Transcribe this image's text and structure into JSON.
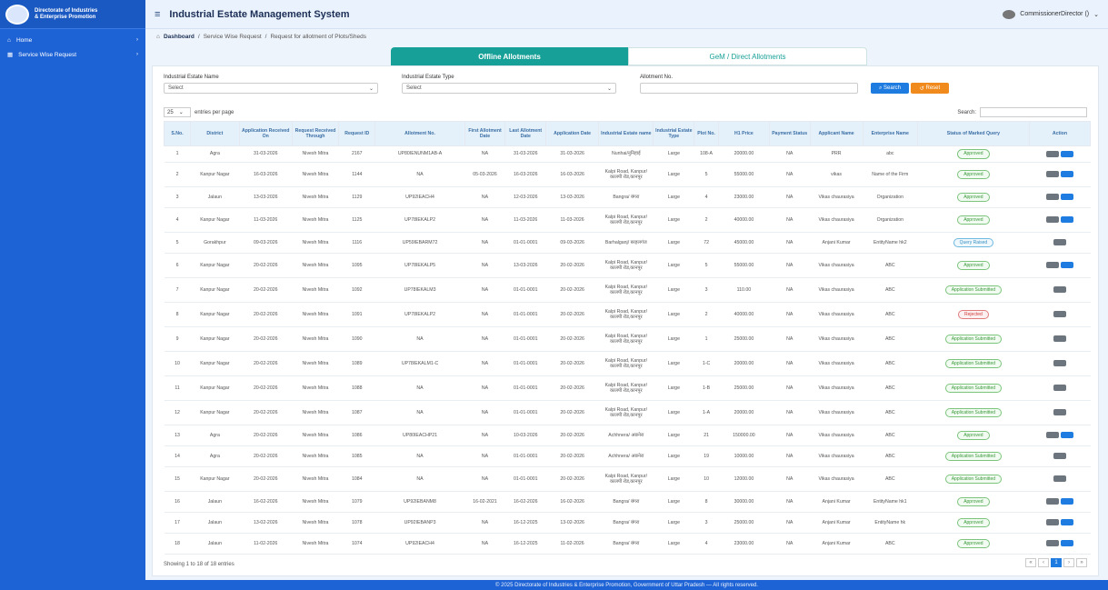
{
  "sidebar": {
    "logo_line1": "Directorate of Industries",
    "logo_line2": "& Enterprise Promotion",
    "items": [
      {
        "label": "Home",
        "icon": "home-icon"
      },
      {
        "label": "Service Wise Request",
        "icon": "grid-icon"
      }
    ]
  },
  "header": {
    "title": "Industrial Estate Management System",
    "user": "CommissionerDirector ()"
  },
  "breadcrumb": [
    "Dashboard",
    "Service Wise Request",
    "Request for allotment of Plots/Sheds"
  ],
  "tabs": [
    "Offline Allotments",
    "GeM / Direct Allotments"
  ],
  "filters": {
    "estate_label": "Industrial Estate Name",
    "estate_value": "Select",
    "type_label": "Industrial Estate Type",
    "type_value": "Select",
    "allotment_label": "Allotment No.",
    "search_btn": "Search",
    "reset_btn": "Reset"
  },
  "table_controls": {
    "page_length": "25",
    "entries_label": "entries per page",
    "search_label": "Search:"
  },
  "columns": [
    "S.No.",
    "District",
    "Application Received On",
    "Request Received Through",
    "Request ID",
    "Allotment No.",
    "First Allotment Date",
    "Last Allotment Date",
    "Application Date",
    "Industrial Estate name",
    "Industrial Estate Type",
    "Plot No.",
    "H1 Price",
    "Payment Status",
    "Applicant Name",
    "Enterprise Name",
    "Status of Marked Query",
    "Action"
  ],
  "rows": [
    {
      "sno": "1",
      "district": "Agra",
      "recv": "31-03-2026",
      "through": "Nivesh Mitra",
      "rid": "2167",
      "allot": "UP80IENUNM1AB-A",
      "first": "NA",
      "last": "31-03-2026",
      "appdate": "31-03-2026",
      "estate": "Nunhai/नुनिहाई",
      "type": "Large",
      "plot": "108-A",
      "price": "20000.00",
      "pay": "NA",
      "applicant": "PRR",
      "enterprise": "abc",
      "status": "Approved",
      "sclass": "a",
      "edit": true
    },
    {
      "sno": "2",
      "district": "Kanpur Nagar",
      "recv": "16-03-2026",
      "through": "Nivesh Mitra",
      "rid": "1144",
      "allot": "NA",
      "first": "05-03-2026",
      "last": "16-03-2026",
      "appdate": "16-03-2026",
      "estate": "Kalpi Road, Kanpur/ कालपी रोड,कानपुर",
      "type": "Large",
      "plot": "5",
      "price": "55000.00",
      "pay": "NA",
      "applicant": "vikas",
      "enterprise": "Name of the Firm",
      "status": "Approved",
      "sclass": "a",
      "edit": true
    },
    {
      "sno": "3",
      "district": "Jalaun",
      "recv": "13-03-2026",
      "through": "Nivesh Mitra",
      "rid": "1129",
      "allot": "UP92IEACH4",
      "first": "NA",
      "last": "12-03-2026",
      "appdate": "13-03-2026",
      "estate": "Bangra/ बंगरा",
      "type": "Large",
      "plot": "4",
      "price": "23000.00",
      "pay": "NA",
      "applicant": "Vikas chaurasiya",
      "enterprise": "Organization",
      "status": "Approved",
      "sclass": "a",
      "edit": true
    },
    {
      "sno": "4",
      "district": "Kanpur Nagar",
      "recv": "11-03-2026",
      "through": "Nivesh Mitra",
      "rid": "1125",
      "allot": "UP78IEKALP2",
      "first": "NA",
      "last": "11-03-2026",
      "appdate": "11-03-2026",
      "estate": "Kalpi Road, Kanpur/ कालपी रोड,कानपुर",
      "type": "Large",
      "plot": "2",
      "price": "40000.00",
      "pay": "NA",
      "applicant": "Vikas chaurasiya",
      "enterprise": "Organization",
      "status": "Approved",
      "sclass": "a",
      "edit": true
    },
    {
      "sno": "5",
      "district": "Gorakhpur",
      "recv": "09-03-2026",
      "through": "Nivesh Mitra",
      "rid": "1116",
      "allot": "UP59IEBARM72",
      "first": "NA",
      "last": "01-01-0001",
      "appdate": "09-03-2026",
      "estate": "Barhalganj/ बरहलगंज",
      "type": "Large",
      "plot": "72",
      "price": "45000.00",
      "pay": "NA",
      "applicant": "Anjani Kumar",
      "enterprise": "EntityName hk2",
      "status": "Query Raised",
      "sclass": "q",
      "edit": false
    },
    {
      "sno": "6",
      "district": "Kanpur Nagar",
      "recv": "20-02-2026",
      "through": "Nivesh Mitra",
      "rid": "1095",
      "allot": "UP78IEKALP5",
      "first": "NA",
      "last": "13-03-2026",
      "appdate": "20-02-2026",
      "estate": "Kalpi Road, Kanpur/ कालपी रोड,कानपुर",
      "type": "Large",
      "plot": "5",
      "price": "55000.00",
      "pay": "NA",
      "applicant": "Vikas chaurasiya",
      "enterprise": "ABC",
      "status": "Approved",
      "sclass": "a",
      "edit": true
    },
    {
      "sno": "7",
      "district": "Kanpur Nagar",
      "recv": "20-02-2026",
      "through": "Nivesh Mitra",
      "rid": "1092",
      "allot": "UP78IEKALM3",
      "first": "NA",
      "last": "01-01-0001",
      "appdate": "20-02-2026",
      "estate": "Kalpi Road, Kanpur/ कालपी रोड,कानपुर",
      "type": "Large",
      "plot": "3",
      "price": "110.00",
      "pay": "NA",
      "applicant": "Vikas chaurasiya",
      "enterprise": "ABC",
      "status": "Application Submitted",
      "sclass": "a",
      "edit": false
    },
    {
      "sno": "8",
      "district": "Kanpur Nagar",
      "recv": "20-02-2026",
      "through": "Nivesh Mitra",
      "rid": "1091",
      "allot": "UP78IEKALP2",
      "first": "NA",
      "last": "01-01-0001",
      "appdate": "20-02-2026",
      "estate": "Kalpi Road, Kanpur/ कालपी रोड,कानपुर",
      "type": "Large",
      "plot": "2",
      "price": "40000.00",
      "pay": "NA",
      "applicant": "Vikas chaurasiya",
      "enterprise": "ABC",
      "status": "Rejected",
      "sclass": "r",
      "edit": false
    },
    {
      "sno": "9",
      "district": "Kanpur Nagar",
      "recv": "20-02-2026",
      "through": "Nivesh Mitra",
      "rid": "1090",
      "allot": "NA",
      "first": "NA",
      "last": "01-01-0001",
      "appdate": "20-02-2026",
      "estate": "Kalpi Road, Kanpur/ कालपी रोड,कानपुर",
      "type": "Large",
      "plot": "1",
      "price": "25000.00",
      "pay": "NA",
      "applicant": "Vikas chaurasiya",
      "enterprise": "ABC",
      "status": "Application Submitted",
      "sclass": "a",
      "edit": false
    },
    {
      "sno": "10",
      "district": "Kanpur Nagar",
      "recv": "20-02-2026",
      "through": "Nivesh Mitra",
      "rid": "1089",
      "allot": "UP78IEKALM1-C",
      "first": "NA",
      "last": "01-01-0001",
      "appdate": "20-02-2026",
      "estate": "Kalpi Road, Kanpur/ कालपी रोड,कानपुर",
      "type": "Large",
      "plot": "1-C",
      "price": "20000.00",
      "pay": "NA",
      "applicant": "Vikas chaurasiya",
      "enterprise": "ABC",
      "status": "Application Submitted",
      "sclass": "a",
      "edit": false
    },
    {
      "sno": "11",
      "district": "Kanpur Nagar",
      "recv": "20-02-2026",
      "through": "Nivesh Mitra",
      "rid": "1088",
      "allot": "NA",
      "first": "NA",
      "last": "01-01-0001",
      "appdate": "20-02-2026",
      "estate": "Kalpi Road, Kanpur/ कालपी रोड,कानपुर",
      "type": "Large",
      "plot": "1-B",
      "price": "25000.00",
      "pay": "NA",
      "applicant": "Vikas chaurasiya",
      "enterprise": "ABC",
      "status": "Application Submitted",
      "sclass": "a",
      "edit": false
    },
    {
      "sno": "12",
      "district": "Kanpur Nagar",
      "recv": "20-02-2026",
      "through": "Nivesh Mitra",
      "rid": "1087",
      "allot": "NA",
      "first": "NA",
      "last": "01-01-0001",
      "appdate": "20-02-2026",
      "estate": "Kalpi Road, Kanpur/ कालपी रोड,कानपुर",
      "type": "Large",
      "plot": "1-A",
      "price": "20000.00",
      "pay": "NA",
      "applicant": "Vikas chaurasiya",
      "enterprise": "ABC",
      "status": "Application Submitted",
      "sclass": "a",
      "edit": false
    },
    {
      "sno": "13",
      "district": "Agra",
      "recv": "20-02-2026",
      "through": "Nivesh Mitra",
      "rid": "1086",
      "allot": "UP80IEACHP21",
      "first": "NA",
      "last": "10-03-2026",
      "appdate": "20-02-2026",
      "estate": "Achhnera/ अछनेरा",
      "type": "Large",
      "plot": "21",
      "price": "150000.00",
      "pay": "NA",
      "applicant": "Vikas chaurasiya",
      "enterprise": "ABC",
      "status": "Approved",
      "sclass": "a",
      "edit": true
    },
    {
      "sno": "14",
      "district": "Agra",
      "recv": "20-02-2026",
      "through": "Nivesh Mitra",
      "rid": "1085",
      "allot": "NA",
      "first": "NA",
      "last": "01-01-0001",
      "appdate": "20-02-2026",
      "estate": "Achhnera/ अछनेरा",
      "type": "Large",
      "plot": "19",
      "price": "10000.00",
      "pay": "NA",
      "applicant": "Vikas chaurasiya",
      "enterprise": "ABC",
      "status": "Application Submitted",
      "sclass": "a",
      "edit": false
    },
    {
      "sno": "15",
      "district": "Kanpur Nagar",
      "recv": "20-02-2026",
      "through": "Nivesh Mitra",
      "rid": "1084",
      "allot": "NA",
      "first": "NA",
      "last": "01-01-0001",
      "appdate": "20-02-2026",
      "estate": "Kalpi Road, Kanpur/ कालपी रोड,कानपुर",
      "type": "Large",
      "plot": "10",
      "price": "12000.00",
      "pay": "NA",
      "applicant": "Vikas chaurasiya",
      "enterprise": "ABC",
      "status": "Application Submitted",
      "sclass": "a",
      "edit": false
    },
    {
      "sno": "16",
      "district": "Jalaun",
      "recv": "16-02-2026",
      "through": "Nivesh Mitra",
      "rid": "1079",
      "allot": "UP92IEBANM8",
      "first": "16-02-2021",
      "last": "16-02-2026",
      "appdate": "16-02-2026",
      "estate": "Bangra/ बंगरा",
      "type": "Large",
      "plot": "8",
      "price": "30000.00",
      "pay": "NA",
      "applicant": "Anjani Kumar",
      "enterprise": "EntityName hk1",
      "status": "Approved",
      "sclass": "a",
      "edit": true
    },
    {
      "sno": "17",
      "district": "Jalaun",
      "recv": "13-02-2026",
      "through": "Nivesh Mitra",
      "rid": "1078",
      "allot": "UP92IEBANP3",
      "first": "NA",
      "last": "16-12-2025",
      "appdate": "13-02-2026",
      "estate": "Bangra/ बंगरा",
      "type": "Large",
      "plot": "3",
      "price": "25000.00",
      "pay": "NA",
      "applicant": "Anjani Kumar",
      "enterprise": "EntityName hk",
      "status": "Approved",
      "sclass": "a",
      "edit": true
    },
    {
      "sno": "18",
      "district": "Jalaun",
      "recv": "11-02-2026",
      "through": "Nivesh Mitra",
      "rid": "1074",
      "allot": "UP92IEACH4",
      "first": "NA",
      "last": "16-12-2025",
      "appdate": "11-02-2026",
      "estate": "Bangra/ बंगरा",
      "type": "Large",
      "plot": "4",
      "price": "23000.00",
      "pay": "NA",
      "applicant": "Anjani Kumar",
      "enterprise": "ABC",
      "status": "Approved",
      "sclass": "a",
      "edit": true
    }
  ],
  "showing": "Showing 1 to 18 of 18 entries",
  "pager": [
    "«",
    "‹",
    "1",
    "›",
    "»"
  ],
  "footer": "© 2025 Directorate of Industries & Enterprise Promotion, Government of Uttar Pradesh — All rights reserved."
}
